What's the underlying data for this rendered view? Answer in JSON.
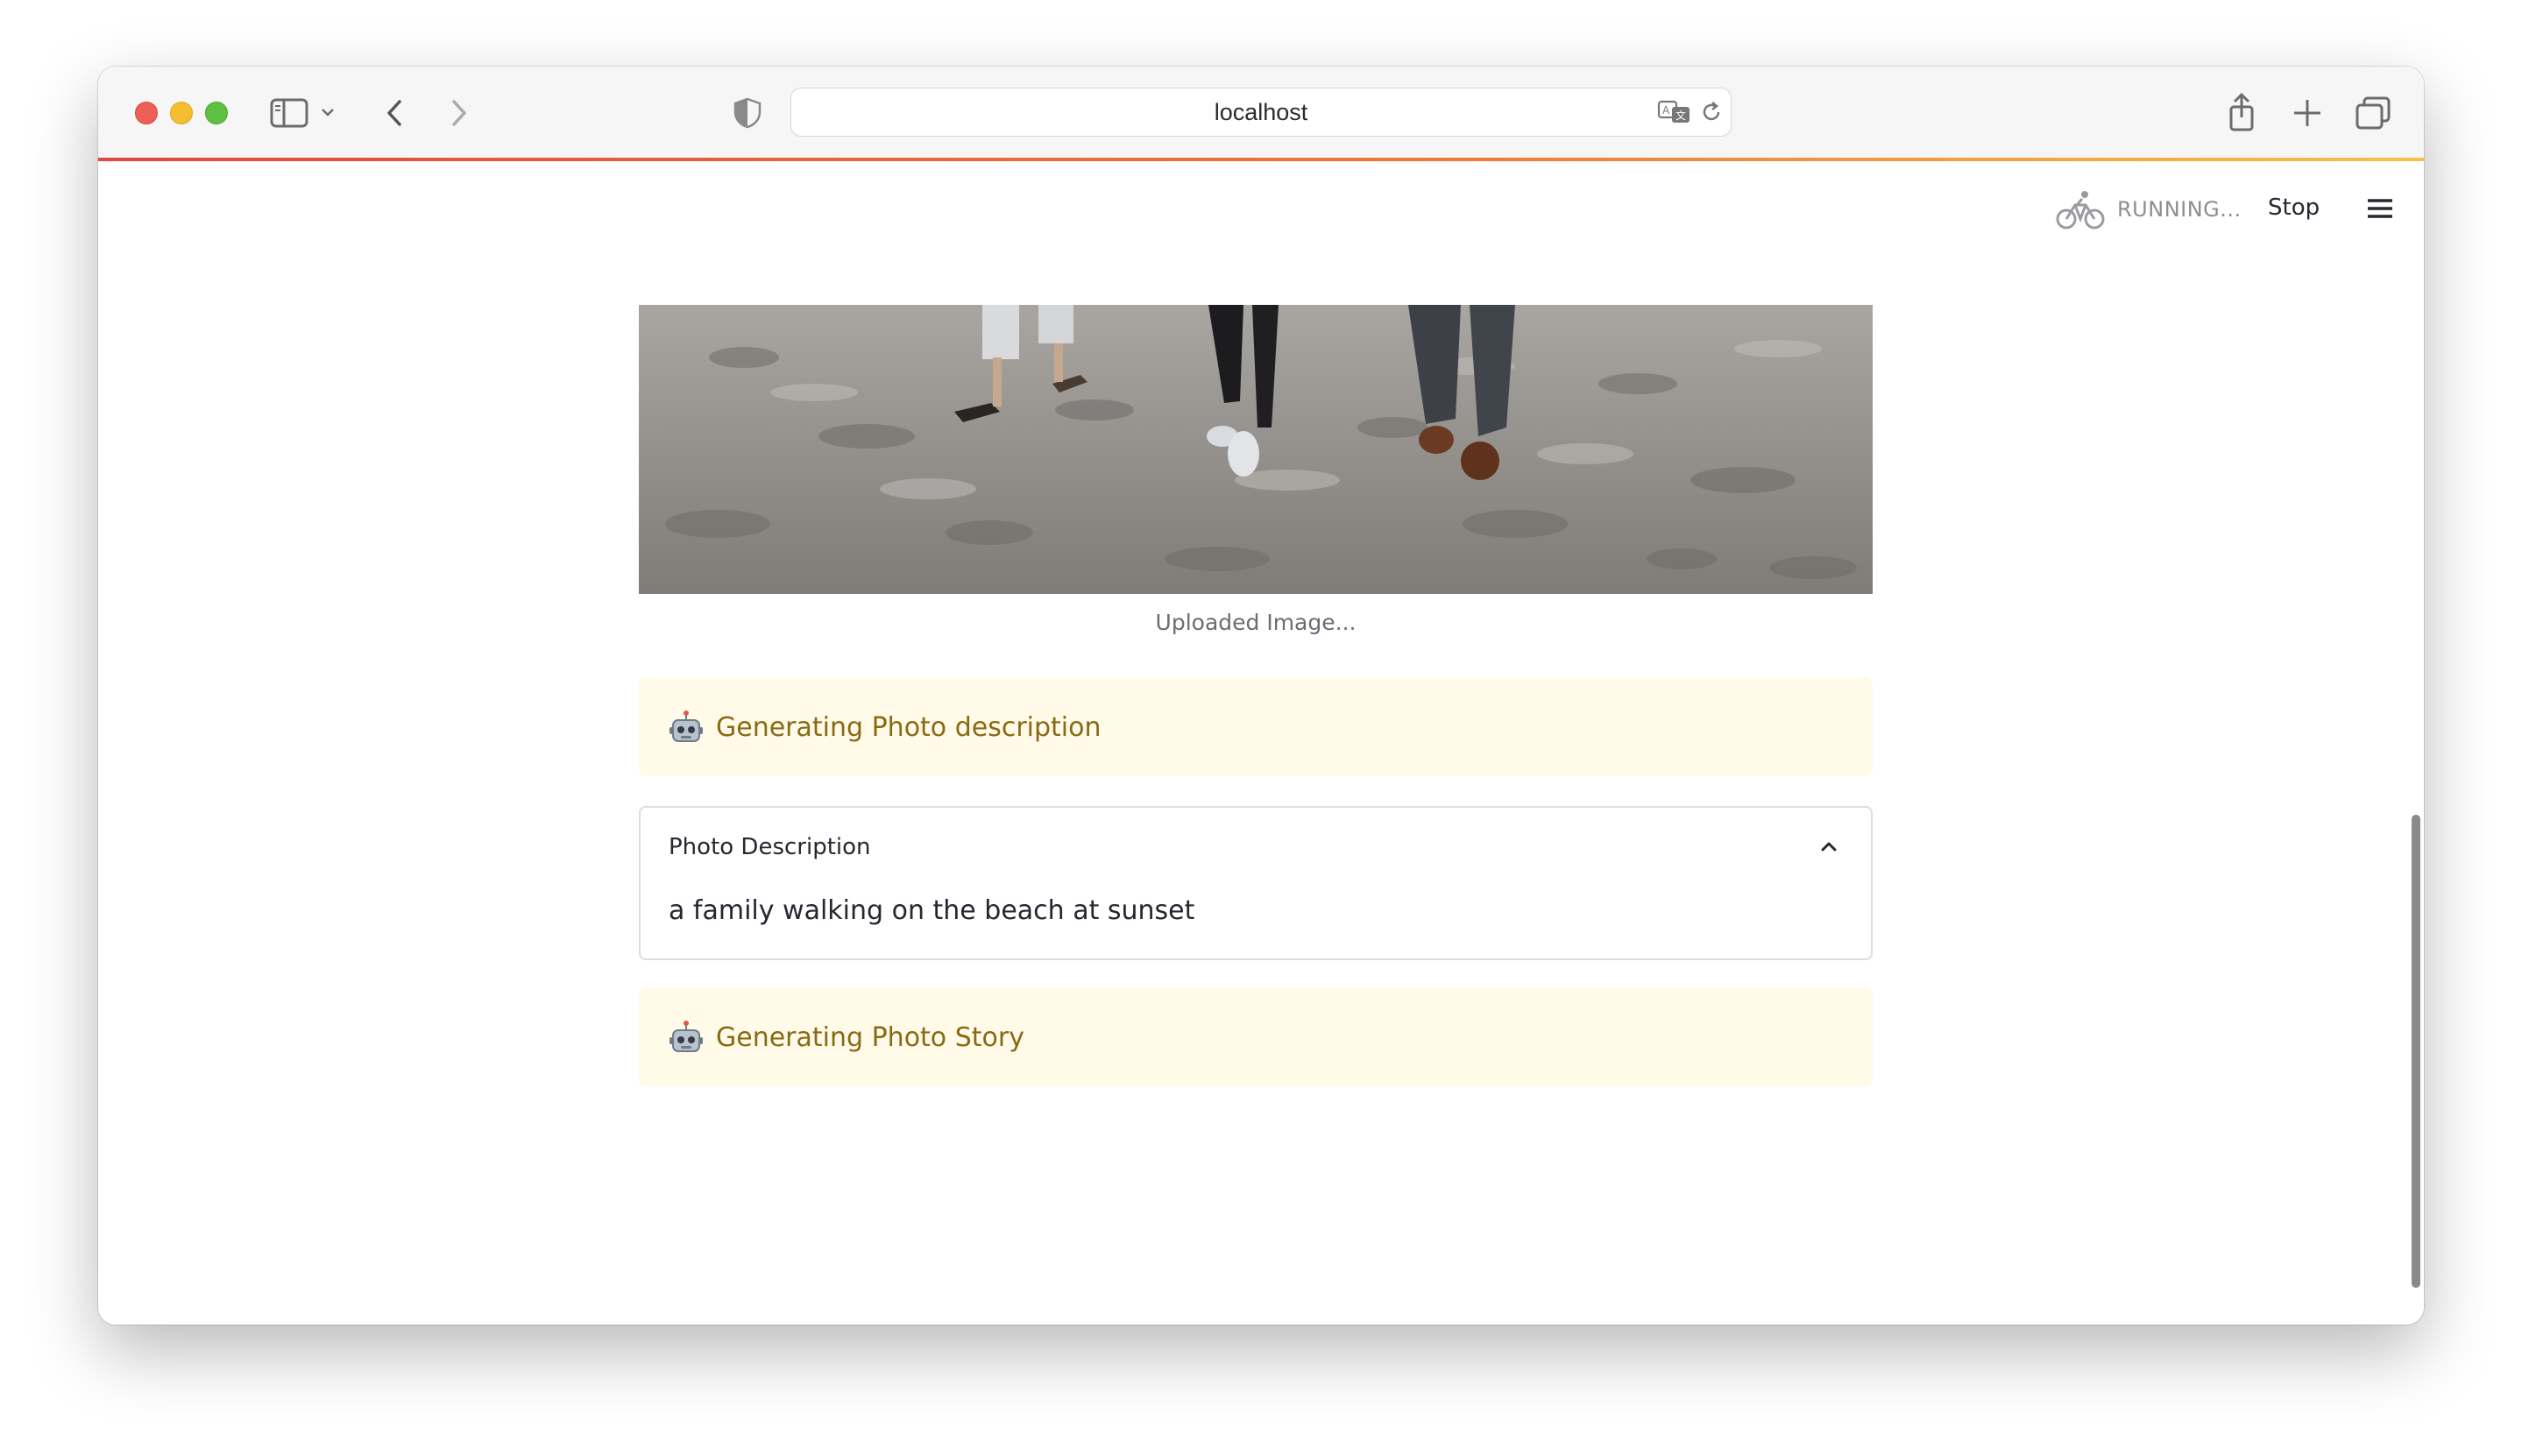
{
  "browser": {
    "url": "localhost",
    "icons": {
      "sidebar": "sidebar-icon",
      "back": "chevron-left-icon",
      "forward": "chevron-right-icon",
      "privacy": "shield-icon",
      "translate": "translate-icon",
      "reload": "reload-icon",
      "share": "share-icon",
      "new_tab": "plus-icon",
      "tabs": "tabs-overview-icon"
    }
  },
  "app": {
    "status": {
      "running_label": "RUNNING...",
      "stop_label": "Stop"
    },
    "image_caption": "Uploaded Image...",
    "alerts": [
      {
        "icon": "robot-icon",
        "text": "Generating Photo description"
      },
      {
        "icon": "robot-icon",
        "text": "Generating Photo Story"
      }
    ],
    "expander": {
      "title": "Photo Description",
      "body": "a family walking on the beach at sunset",
      "expanded": true
    }
  },
  "colors": {
    "loading_bar": [
      "#e0493f",
      "#f6c14a"
    ],
    "alert_background": "#fffbe8",
    "alert_text": "#8a6914",
    "primary_text": "#262730"
  }
}
